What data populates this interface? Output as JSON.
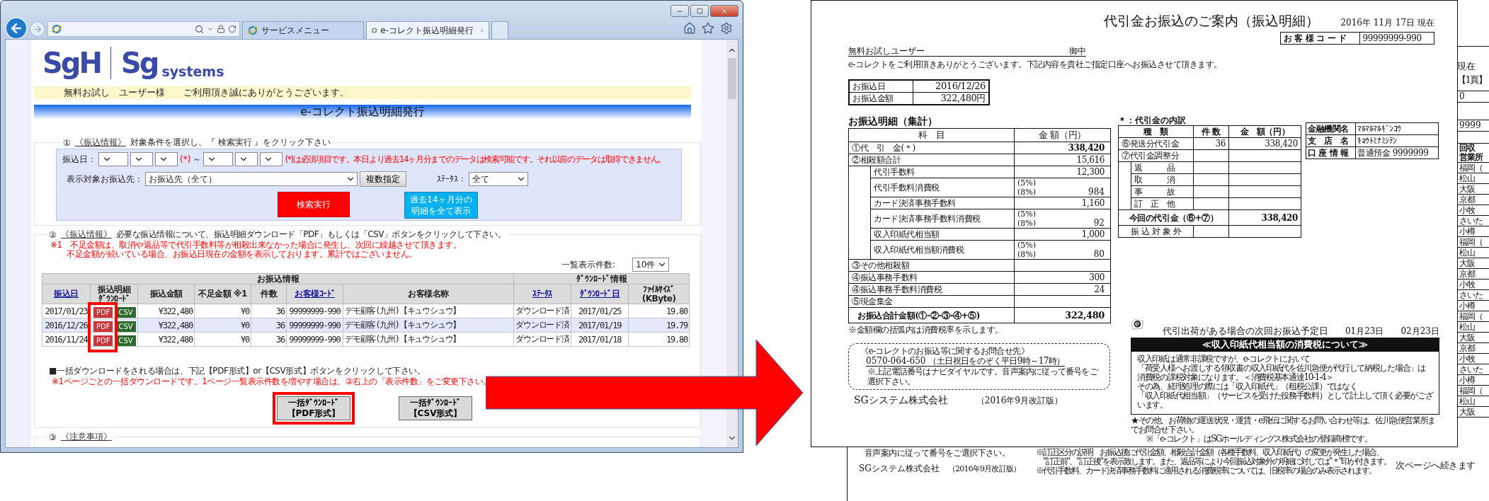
{
  "browser": {
    "tabs": [
      {
        "label": "サービスメニュー",
        "selected": false
      },
      {
        "label": "e-コレクト振込明細発行",
        "selected": true
      }
    ]
  },
  "page": {
    "logos": [
      {
        "mark": "SgH"
      },
      {
        "mark": "Sg",
        "wordmark": "systems"
      }
    ],
    "welcome": "無料お試し　ユーザー様　　ご利用頂き誠にありがとうございます。",
    "title": "e-コレクト振込明細発行",
    "section1": {
      "number": "①",
      "link": "《振込情報》",
      "instruction": "対象条件を選択し、『 検索実行 』をクリック下さい",
      "date_label": "振込日：",
      "required_mark": "(*)",
      "tilde": "～",
      "required_note": "(*)は必須項目です。本日より過去14ヶ月分までのデータは検索可能です。それ以前のデータは取得できません。",
      "payee_label": "表示対象お振込先：",
      "payee_value": "お振込先（全て）",
      "multi_button": "複数指定",
      "status_label": "ｽﾃｰﾀｽ：",
      "status_value": "全て",
      "search_button": "検索実行",
      "all_button": [
        "過去14ヶ月分の",
        "明細を全て表示"
      ]
    },
    "section2": {
      "number": "②",
      "link": "《振込情報》",
      "instruction": "必要な振込情報について、振込明細ダウンロード「PDF」もしくは「CSV」ボタンをクリックして下さい。",
      "notes": [
        "※1　不足金額は、取消や返品等で代引手数料等が相殺出来なかった場合に発生し、次回に繰越させて頂きます。",
        "不足金額が続いている場合、お振込日現在の金額を表示しております。累計ではございません。"
      ],
      "page_size_label": "一覧表示件数:",
      "page_size": "10件",
      "groups": [
        {
          "label": "お振込情報",
          "columns": [
            {
              "lines": [
                "振込日"
              ],
              "link": true,
              "highlighted": false
            },
            {
              "lines": [
                "振込明細",
                "ﾀﾞｳﾝﾛｰﾄﾞ"
              ],
              "link": false,
              "highlighted": true
            },
            {
              "lines": [
                "振込金額"
              ],
              "link": false,
              "highlighted": false
            },
            {
              "lines": [
                "不足金額 ※1"
              ],
              "link": false,
              "highlighted": false
            },
            {
              "lines": [
                "件数"
              ],
              "link": false,
              "highlighted": false
            },
            {
              "lines": [
                "お客様ｺｰﾄﾞ"
              ],
              "link": true,
              "highlighted": false
            },
            {
              "lines": [
                "お客様名称"
              ],
              "link": false,
              "highlighted": false
            }
          ]
        },
        {
          "label": "ﾀﾞｳﾝﾛｰﾄﾞ情報",
          "columns": [
            {
              "lines": [
                "ｽﾃｰﾀｽ"
              ],
              "link": true,
              "highlighted": false
            },
            {
              "lines": [
                "ﾀﾞｳﾝﾛｰﾄﾞ日"
              ],
              "link": true,
              "highlighted": false
            },
            {
              "lines": [
                "ﾌｧｲﾙｻｲｽﾞ",
                "(KByte)"
              ],
              "link": false,
              "highlighted": false
            }
          ]
        }
      ],
      "rows": [
        {
          "cells": [
            "2017/01/23",
            [
              "PDF",
              "CSV"
            ],
            "¥322,480",
            "¥0",
            "36",
            "99999999-990",
            "デモ顧客(九州)【キュウシュウ】",
            "ダウンロード済",
            "2017/01/25",
            "19.80"
          ]
        },
        {
          "cells": [
            "2016/12/26",
            [
              "PDF",
              "CSV"
            ],
            "¥322,480",
            "¥0",
            "36",
            "99999999-990",
            "デモ顧客(九州)【キュウシュウ】",
            "ダウンロード済",
            "2017/01/19",
            "19.79"
          ]
        },
        {
          "cells": [
            "2016/11/24",
            [
              "PDF",
              "CSV"
            ],
            "¥322,480",
            "¥0",
            "36",
            "99999999-990",
            "デモ顧客(九州)【キュウシュウ】",
            "ダウンロード済",
            "2017/01/18",
            "19.80"
          ]
        }
      ],
      "bulk_note": "■一括ダウンロードをされる場合は、下記【PDF形式】or【CSV形式】ボタンをクリックして下さい。",
      "bulk_warning": "※1ページごとの一括ダウンロードです。1ページ一覧表示件数を増やす場合は、②右上の「表示件数」をご変更下さい。",
      "bulk_buttons": [
        {
          "lines": [
            "一括ﾀﾞｳﾝﾛｰﾄﾞ",
            "【PDF形式】"
          ],
          "highlighted": true
        },
        {
          "lines": [
            "一括ﾀﾞｳﾝﾛｰﾄﾞ",
            "【CSV形式】"
          ],
          "highlighted": false
        }
      ]
    },
    "section3": {
      "number": "③",
      "link": "《注意事項》"
    }
  },
  "statement": {
    "title": "代引金お振込のご案内（振込明細）",
    "as_of": "2016年 11月 17日 現在",
    "code_label": "お 客 様 コ ー ド",
    "code": "99999999-990",
    "addressee": "無料お試しユーザー",
    "honorific": "御中",
    "greeting": "e-コレクトをご利用頂きありがとうございます。下記内容を貴社ご指定口座へお振込させて頂きます。",
    "summary": [
      {
        "label": "お振込日",
        "value": "2016/12/26"
      },
      {
        "label": "お振込金額",
        "value": "322,480円"
      }
    ],
    "detail_heading": "お振込明細（集計）",
    "detail_columns": [
      "科　目",
      "金 額（円）"
    ],
    "detail_rows": [
      {
        "label": "①代　引　金(＊)",
        "value": "338,420",
        "bold": true
      },
      {
        "label": "②相殺額合計",
        "value": "15,616",
        "bold": false,
        "children": [
          {
            "label": "代引手数料",
            "value": "12,300"
          },
          {
            "label": "代引手数料消費税",
            "rates": [
              "(5%)",
              "(8%)"
            ],
            "value": "984"
          },
          {
            "label": "カード決済事務手数料",
            "value": "1,160"
          },
          {
            "label": "カード決済事務手数料消費税",
            "rates": [
              "(5%)",
              "(8%)"
            ],
            "value": "92"
          },
          {
            "label": "収入印紙代相当額",
            "value": "1,000"
          },
          {
            "label": "収入印紙代相当額消費税",
            "rates": [
              "(5%)",
              "(8%)"
            ],
            "value": "80"
          }
        ]
      },
      {
        "label": "③その他相殺額"
      },
      {
        "label": "④振込事務手数料",
        "value": "300",
        "bold": false
      },
      {
        "label": "④振込事務手数料消費税",
        "value": "24",
        "bold": false
      },
      {
        "label": "⑤現金集金"
      }
    ],
    "total": {
      "label": "お振込合計金額(①-②-③-④+⑤)",
      "value": "322,480"
    },
    "detail_note": "※金額欄の括弧内は消費税率を示します。",
    "breakdown": {
      "title": "＊：代引金の内訳",
      "columns": [
        "種　類",
        "件 数",
        "金　額（円）"
      ],
      "rows": [
        {
          "label": "⑥発送分代引金",
          "count": "36",
          "amount": "338,420"
        },
        {
          "label": "⑦代引金調整分",
          "children": [
            {
              "label": "返　　　品"
            },
            {
              "label": "取　　　消"
            },
            {
              "label": "事　　　故"
            },
            {
              "label": "訂　正　他"
            }
          ]
        }
      ],
      "subtotal": {
        "label": "今回の代引金（⑥+⑦）",
        "amount": "338,420"
      },
      "excluded": "振 込 対 象 外"
    },
    "bank": [
      {
        "label": "金融機関名",
        "value": "ﾏﾙﾏﾙﾏﾙｷﾞﾝｺｳ"
      },
      {
        "label": "支　店　名",
        "value": "ｷｮｳﾄﾐﾅﾐｼﾃﾝ"
      },
      {
        "label": "口 座 情 報",
        "value": "普通預金 9999999"
      }
    ],
    "next_date": {
      "label": "代引出荷がある場合の次回お振込予定日",
      "dates": [
        "01月23日",
        "02月23日"
      ]
    },
    "notice": {
      "title": "≪収入印紙代相当額の消費税について≫",
      "lines": [
        "収入印紙は通常非課税ですが、e-コレクトにおいて",
        "「荷受人様へお渡しする領収書の収入印紙代を佐川急便が代行して納税した場合」は",
        "消費税の課税対象になります。＜消費税基本通達10-1-4＞",
        "その為、経理処理の際には「収入印紙代」（租税公課）ではなく",
        "「収入印紙代相当額」（サービスを受けた役務手数料）として計上して頂く必要がございます。"
      ]
    },
    "footnotes": [
      "★その他、お荷物の運送状況・運賃・e飛伝に関するお問い合わせ等は、佐川急便営業所までお問合せ下さい。",
      "※「e-コレクト」はSGホールディングス株式会社の登録商標です。"
    ],
    "contact": {
      "title": "《e-コレクトのお振込等に関するお問合せ先》",
      "phone": "0570-064-650",
      "hours": "（土日祝日をのぞく平日9時～17時）",
      "note": "※上記電話番号はナビダイヤルです。音声案内に従って番号をご選択下さい。"
    },
    "company": "SGシステム株式会社",
    "revision": "（2016年9月改訂版）"
  },
  "back_page": {
    "as_of_tail": "現在",
    "page_no": "【1頁】",
    "code_tail": "0",
    "account_tail": "9999",
    "column_head": [
      "回収",
      "営業所"
    ],
    "offices": [
      "福岡（",
      "松山",
      "大阪",
      "京都",
      "小牧",
      "さいた",
      "小樽",
      "福岡（",
      "松山",
      "大阪",
      "京都",
      "小牧",
      "さいた",
      "小樽",
      "福岡（",
      "松山",
      "大阪",
      "京都",
      "小牧",
      "さいた",
      "小樽",
      "福岡（",
      "松山",
      "大阪"
    ],
    "contact_tail": "音声案内に従って番号をご選択下さい。",
    "company": "SGシステム株式会社",
    "revision": "（2016年9月改訂版）",
    "notes": [
      "※訂正区分の説明　お振込後に代引金額、相殺合計金額（各種手数料、収入印紙代）の変更が発生した場合、",
      "\"訂正前\"、\"訂正後\"を表示致します。また、返品等により今回振込対象外の明細に対しては\"＊\"印が付きます。",
      "※代引手数料、カード決済事務手数料に適用される消費税率については、旧税率の場合のみ表示されます。"
    ],
    "continued": "次ページへ続きます"
  }
}
